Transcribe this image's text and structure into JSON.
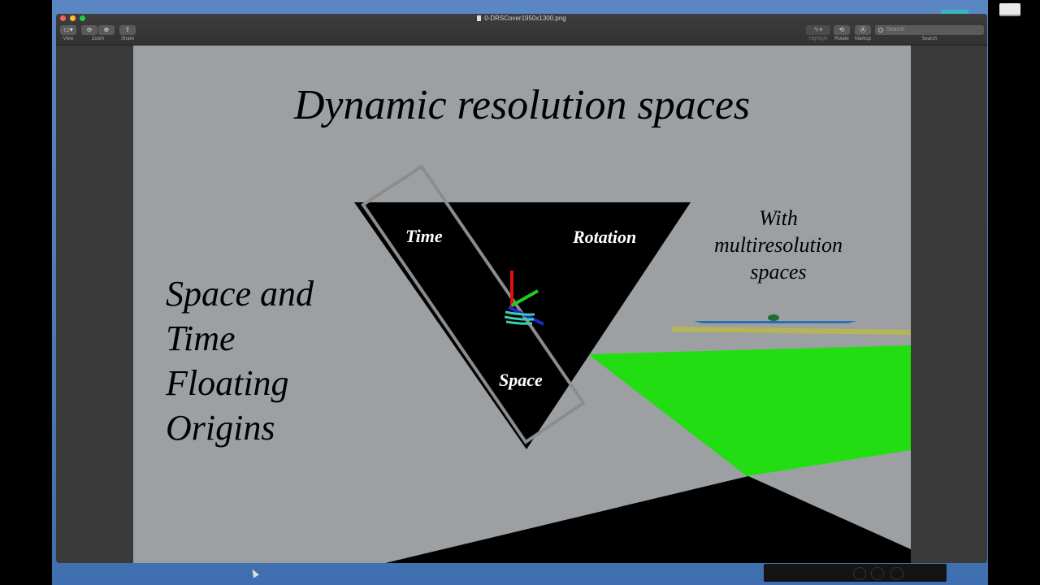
{
  "window": {
    "title": "0-DRSCover1950x1300.png"
  },
  "toolbar": {
    "view_label": "View",
    "zoom_label": "Zoom",
    "share_label": "Share",
    "highlight_label": "Highlight",
    "rotate_label": "Rotate",
    "markup_label": "Markup",
    "search_placeholder": "Search",
    "search_label": "Search"
  },
  "slide": {
    "title": "Dynamic resolution spaces",
    "side_lines": [
      "Space and",
      "Time",
      "Floating",
      "Origins"
    ],
    "triangle_labels": {
      "time": "Time",
      "rotation": "Rotation",
      "space": "Space"
    },
    "multi_lines": [
      "With",
      "multiresolution",
      "spaces"
    ]
  },
  "colors": {
    "slide_background": "#9da0a3",
    "plane": "#22dd11",
    "axis_x": "#1a2bcc",
    "axis_y": "#22cc22",
    "axis_z": "#dd1111"
  }
}
